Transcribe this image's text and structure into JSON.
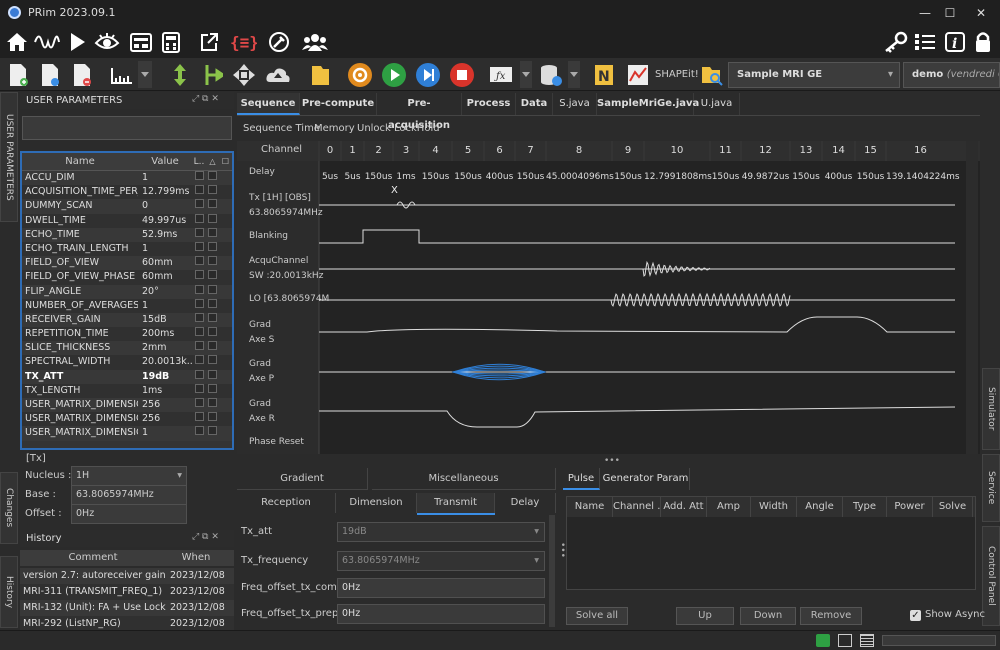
{
  "window": {
    "title": "PRim 2023.09.1",
    "min": "—",
    "max": "☐",
    "close": "✕"
  },
  "toolbar": {
    "shape_label": "SHAPEit!",
    "sequence_combo": "Sample MRI GE",
    "user_combo": "demo",
    "user_combo_suffix": "(vendredi 0"
  },
  "left_panel": {
    "title": "USER PARAMETERS",
    "headers": {
      "name": "Name",
      "value": "Value",
      "l": "L..",
      "a": "△",
      "b": "☐"
    },
    "params": [
      {
        "name": "ACCU_DIM",
        "value": "1"
      },
      {
        "name": "ACQUISITION_TIME_PER_S...",
        "value": "12.799ms"
      },
      {
        "name": "DUMMY_SCAN",
        "value": "0"
      },
      {
        "name": "DWELL_TIME",
        "value": "49.997us"
      },
      {
        "name": "ECHO_TIME",
        "value": "52.9ms"
      },
      {
        "name": "ECHO_TRAIN_LENGTH",
        "value": "1"
      },
      {
        "name": "FIELD_OF_VIEW",
        "value": "60mm"
      },
      {
        "name": "FIELD_OF_VIEW_PHASE",
        "value": "60mm"
      },
      {
        "name": "FLIP_ANGLE",
        "value": "20°"
      },
      {
        "name": "NUMBER_OF_AVERAGES",
        "value": "1"
      },
      {
        "name": "RECEIVER_GAIN",
        "value": "15dB"
      },
      {
        "name": "REPETITION_TIME",
        "value": "200ms"
      },
      {
        "name": "SLICE_THICKNESS",
        "value": "2mm"
      },
      {
        "name": "SPECTRAL_WIDTH",
        "value": "20.0013k..."
      },
      {
        "name": "TX_ATT",
        "value": "19dB",
        "bold": true
      },
      {
        "name": "TX_LENGTH",
        "value": "1ms"
      },
      {
        "name": "USER_MATRIX_DIMENSIO...",
        "value": "256"
      },
      {
        "name": "USER_MATRIX_DIMENSIO...",
        "value": "256"
      },
      {
        "name": "USER_MATRIX_DIMENSIO...",
        "value": "1"
      }
    ],
    "tx_section": "[Tx]",
    "nucleus_label": "Nucleus :",
    "nucleus_value": "1H",
    "base_label": "Base :",
    "base_value": "63.8065974MHz",
    "offset_label": "Offset :",
    "offset_value": "0Hz"
  },
  "history": {
    "title": "History",
    "col_comment": "Comment",
    "col_when": "When",
    "rows": [
      {
        "comment": "version 2.7: autoreceiver gain co...",
        "when": "2023/12/08"
      },
      {
        "comment": "MRI-311 (TRANSMIT_FREQ_1)",
        "when": "2023/12/08"
      },
      {
        "comment": "MRI-132 (Unit): FA + Use Lock in...",
        "when": "2023/12/08"
      },
      {
        "comment": "MRI-292 (ListNP_RG)",
        "when": "2023/12/08"
      }
    ]
  },
  "side_tabs": {
    "user_parameters": "USER PARAMETERS",
    "changes": "Changes",
    "history": "History",
    "simulator": "Simulator",
    "service": "Service",
    "control_panel": "Control Panel"
  },
  "main_tabs": [
    "Sequence",
    "Pre-compute",
    "Pre-acquisition",
    "Process",
    "Data",
    "S.java",
    "SampleMriGe.java",
    "U.java"
  ],
  "sub_tabs": [
    "Sequence Time",
    "Memory",
    "Unlock",
    "LockHold"
  ],
  "timeline": {
    "channel_header": "Channel",
    "columns": [
      "0",
      "1",
      "2",
      "3",
      "4",
      "5",
      "6",
      "7",
      "8",
      "9",
      "10",
      "11",
      "12",
      "13",
      "14",
      "15",
      "16"
    ],
    "delays": [
      "5us",
      "5us",
      "150us",
      "1ms",
      "150us",
      "150us",
      "400us",
      "150us",
      "45.0004096ms",
      "150us",
      "12.7991808ms",
      "150us",
      "49.9872us",
      "150us",
      "400us",
      "150us",
      "139.1404224ms"
    ],
    "delay_label": "Delay",
    "tx_label": "Tx [1H] [OBS]",
    "tx_sub": "63.8065974MHz",
    "tx_marker": "X",
    "blanking_label": "Blanking",
    "acqu_label": "AcquChannel",
    "acqu_sub": "SW :20.0013kHz",
    "lo_label": "LO [63.8065974M",
    "grad_s_label": "Grad",
    "grad_s_sub": "Axe S",
    "grad_p_label": "Grad",
    "grad_p_sub": "Axe P",
    "grad_r_label": "Grad",
    "grad_r_sub": "Axe R",
    "phase_reset_label": "Phase Reset"
  },
  "bottom_tabs": {
    "row1": [
      "Gradient",
      "Miscellaneous"
    ],
    "row2": [
      "Reception",
      "Dimension",
      "Transmit",
      "Delay"
    ]
  },
  "transmit": {
    "fields": [
      {
        "label": "Tx_att",
        "value": "19dB",
        "combo": true
      },
      {
        "label": "Tx_frequency",
        "value": "63.8065974MHz",
        "combo": true
      },
      {
        "label": "Freq_offset_tx_comp",
        "value": "0Hz",
        "combo": false
      },
      {
        "label": "Freq_offset_tx_prep",
        "value": "0Hz",
        "combo": false
      }
    ]
  },
  "pulse_panel": {
    "tabs": [
      "Pulse",
      "Generator Param"
    ],
    "columns": [
      "Name",
      "Channel ...",
      "Add. Att",
      "Amp",
      "Width",
      "Angle",
      "Type",
      "Power",
      "Solve"
    ],
    "solve_all": "Solve all",
    "up": "Up",
    "down": "Down",
    "remove": "Remove",
    "show_async": "Show Async"
  },
  "colors": {
    "accent": "#3a8ee6",
    "orange": "#e08a1e",
    "green": "#2ea043",
    "blue": "#2f7fd6",
    "red": "#d9342b",
    "panel": "#2b2b2b"
  }
}
